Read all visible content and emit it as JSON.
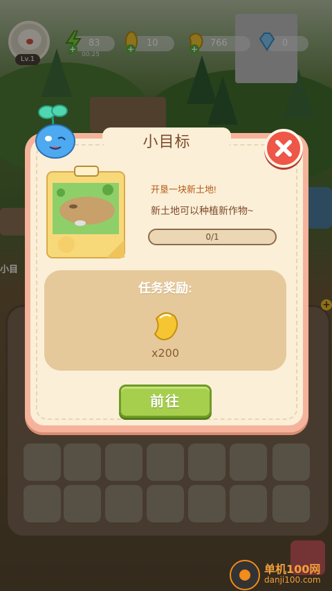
{
  "hud": {
    "level": "Lv.1",
    "energy": "83",
    "energy_timer": "00:25",
    "corn": "10",
    "beans": "766",
    "gems": "0"
  },
  "modal": {
    "title": "小目标",
    "task_title": "开垦一块新土地!",
    "task_desc": "新土地可以种植新作物~",
    "progress_text": "0/1",
    "progress_fraction": 0,
    "reward_label": "任务奖励:",
    "reward_amount": "x200",
    "go_button": "前往"
  },
  "side": {
    "left_label": "小目"
  },
  "watermark": {
    "name": "单机100网",
    "url": "danji100.com"
  },
  "colors": {
    "accent_orange": "#f6b39b",
    "close_red": "#ee5648",
    "go_green": "#a7cf4e",
    "panel_cream": "#fbefd8"
  }
}
